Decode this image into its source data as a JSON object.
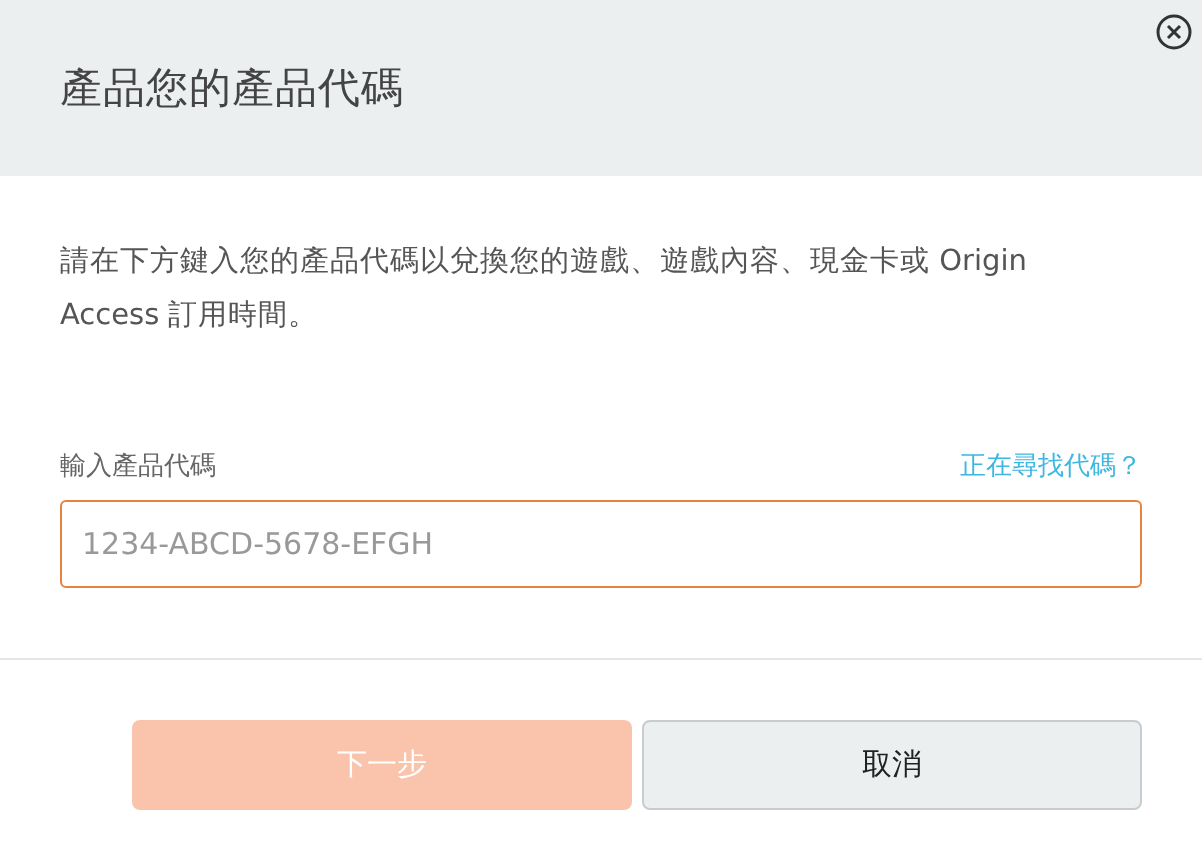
{
  "dialog": {
    "title": "產品您的產品代碼"
  },
  "description": "請在下方鍵入您的產品代碼以兌換您的遊戲、遊戲內容、現金卡或 Origin Access 訂用時間。",
  "code_field": {
    "label": "輸入產品代碼",
    "help_link": "正在尋找代碼？",
    "placeholder": "1234-ABCD-5678-EFGH",
    "focused": true
  },
  "buttons": [
    {
      "label": "下一步",
      "kind": "primary",
      "disabled": true
    },
    {
      "label": "取消",
      "kind": "secondary",
      "disabled": false
    }
  ]
}
